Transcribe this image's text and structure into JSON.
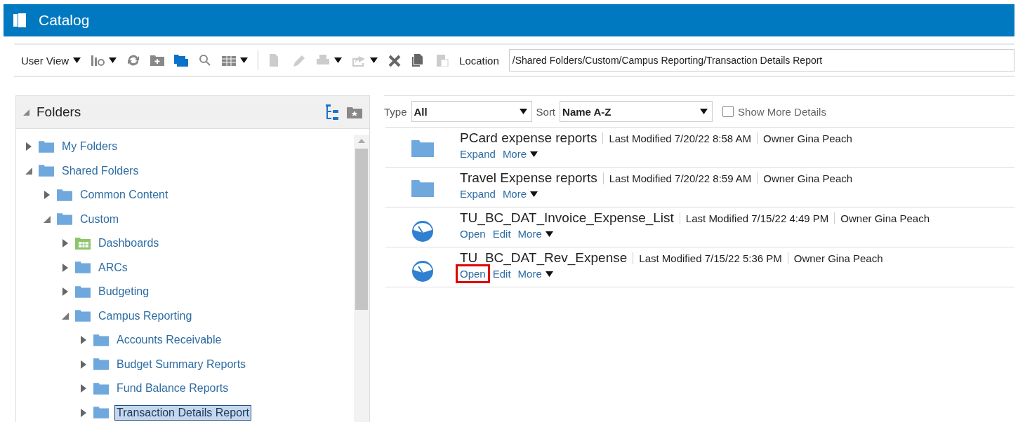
{
  "window": {
    "title": "Catalog"
  },
  "toolbar": {
    "view_menu": "User View",
    "location_label": "Location",
    "location_value": "/Shared Folders/Custom/Campus Reporting/Transaction Details Report"
  },
  "folders_panel": {
    "title": "Folders",
    "expanded": true,
    "tree": [
      {
        "name": "My Folders",
        "kind": "folder",
        "expanded": false,
        "selected": false
      },
      {
        "name": "Shared Folders",
        "kind": "folder",
        "expanded": true,
        "selected": false,
        "children": [
          {
            "name": "Common Content",
            "kind": "folder",
            "expanded": false,
            "selected": false
          },
          {
            "name": "Custom",
            "kind": "folder",
            "expanded": true,
            "selected": false,
            "children": [
              {
                "name": "Dashboards",
                "kind": "dashboard",
                "expanded": false,
                "selected": false
              },
              {
                "name": "ARCs",
                "kind": "folder",
                "expanded": false,
                "selected": false
              },
              {
                "name": "Budgeting",
                "kind": "folder",
                "expanded": false,
                "selected": false
              },
              {
                "name": "Campus Reporting",
                "kind": "folder",
                "expanded": true,
                "selected": false,
                "children": [
                  {
                    "name": "Accounts Receivable",
                    "kind": "folder",
                    "expanded": false,
                    "selected": false
                  },
                  {
                    "name": "Budget Summary Reports",
                    "kind": "folder",
                    "expanded": false,
                    "selected": false
                  },
                  {
                    "name": "Fund Balance Reports",
                    "kind": "folder",
                    "expanded": false,
                    "selected": false
                  },
                  {
                    "name": "Transaction Details Report",
                    "kind": "folder",
                    "expanded": false,
                    "selected": true
                  }
                ]
              }
            ]
          }
        ]
      }
    ]
  },
  "filters": {
    "type_label": "Type",
    "type_value": "All",
    "sort_label": "Sort",
    "sort_value": "Name A-Z",
    "show_details_label": "Show More Details",
    "show_details_checked": false
  },
  "items": [
    {
      "kind": "folder",
      "name": "PCard expense reports",
      "modified": "Last Modified 7/20/22 8:58 AM",
      "owner": "Owner Gina Peach",
      "actions": [
        {
          "label": "Expand",
          "menu": false,
          "highlighted": false
        },
        {
          "label": "More",
          "menu": true,
          "highlighted": false
        }
      ]
    },
    {
      "kind": "folder",
      "name": "Travel Expense reports",
      "modified": "Last Modified 7/20/22 8:59 AM",
      "owner": "Owner Gina Peach",
      "actions": [
        {
          "label": "Expand",
          "menu": false,
          "highlighted": false
        },
        {
          "label": "More",
          "menu": true,
          "highlighted": false
        }
      ]
    },
    {
      "kind": "analysis",
      "name": "TU_BC_DAT_Invoice_Expense_List",
      "modified": "Last Modified 7/15/22 4:49 PM",
      "owner": "Owner Gina Peach",
      "actions": [
        {
          "label": "Open",
          "menu": false,
          "highlighted": false
        },
        {
          "label": "Edit",
          "menu": false,
          "highlighted": false
        },
        {
          "label": "More",
          "menu": true,
          "highlighted": false
        }
      ]
    },
    {
      "kind": "analysis",
      "name": "TU_BC_DAT_Rev_Expense",
      "modified": "Last Modified 7/15/22 5:36 PM",
      "owner": "Owner Gina Peach",
      "actions": [
        {
          "label": "Open",
          "menu": false,
          "highlighted": true
        },
        {
          "label": "Edit",
          "menu": false,
          "highlighted": false
        },
        {
          "label": "More",
          "menu": true,
          "highlighted": false
        }
      ]
    }
  ]
}
